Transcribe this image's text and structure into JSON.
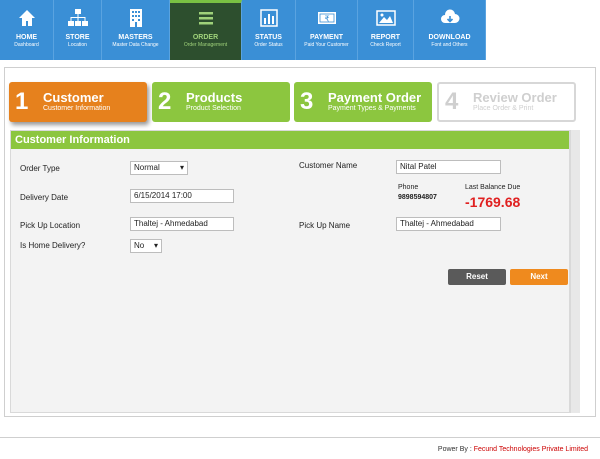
{
  "nav": [
    {
      "title": "HOME",
      "sub": "Dashboard",
      "icon": "home-icon"
    },
    {
      "title": "STORE",
      "sub": "Location",
      "icon": "sitemap-icon"
    },
    {
      "title": "MASTERS",
      "sub": "Master Data Change",
      "icon": "building-icon"
    },
    {
      "title": "ORDER",
      "sub": "Order Management",
      "icon": "menu-icon"
    },
    {
      "title": "STATUS",
      "sub": "Order Status",
      "icon": "chart-icon"
    },
    {
      "title": "PAYMENT",
      "sub": "Paid Your Customer",
      "icon": "money-icon"
    },
    {
      "title": "REPORT",
      "sub": "Check Report",
      "icon": "image-icon"
    },
    {
      "title": "DOWNLOAD",
      "sub": "Font and Others",
      "icon": "cloud-download-icon"
    }
  ],
  "steps": [
    {
      "num": "1",
      "title": "Customer",
      "sub": "Customer Information"
    },
    {
      "num": "2",
      "title": "Products",
      "sub": "Product Selection"
    },
    {
      "num": "3",
      "title": "Payment Order",
      "sub": "Payment Types & Payments"
    },
    {
      "num": "4",
      "title": "Review Order",
      "sub": "Place Order & Print"
    }
  ],
  "panel": {
    "title": "Customer Information"
  },
  "form": {
    "order_type_label": "Order Type",
    "order_type_value": "Normal",
    "customer_name_label": "Customer Name",
    "customer_name_value": "Nital  Patel",
    "delivery_date_label": "Delivery Date",
    "delivery_date_value": "6/15/2014 17:00",
    "phone_label": "Phone",
    "phone_value": "9898594807",
    "balance_label": "Last Balance Due",
    "balance_value": "-1769.68",
    "pickup_location_label": "Pick Up Location",
    "pickup_location_value": "Thaltej - Ahmedabad",
    "pickup_name_label": "Pick Up Name",
    "pickup_name_value": "Thaltej - Ahmedabad",
    "home_delivery_label": "Is Home Delivery?",
    "home_delivery_value": "No"
  },
  "buttons": {
    "reset": "Reset",
    "next": "Next"
  },
  "footer": {
    "prefix": "Power By : ",
    "company": "Fecund Technologies Private Limited"
  }
}
